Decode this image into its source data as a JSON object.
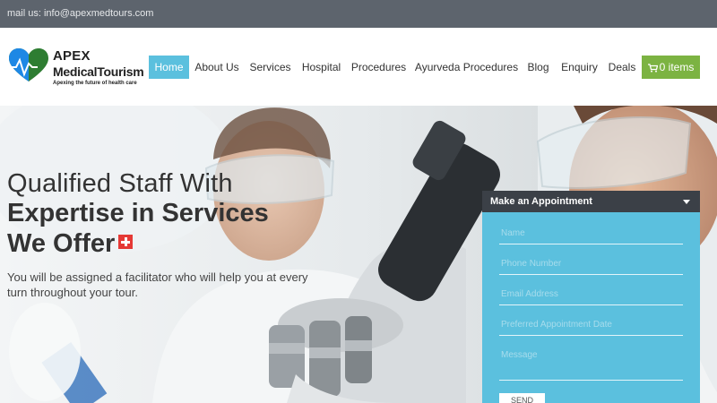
{
  "topbar": {
    "mail": "mail us: info@apexmedtours.com"
  },
  "logo": {
    "line1": "APEX",
    "line2": "MedicalTourism",
    "tagline": "Apexing the future of health care"
  },
  "nav": {
    "items": [
      {
        "label": "Home",
        "active": true
      },
      {
        "label": "About Us",
        "active": false
      },
      {
        "label": "Services",
        "active": false
      },
      {
        "label": "Hospital",
        "active": false
      },
      {
        "label": "Procedures",
        "active": false
      },
      {
        "label": "Ayurveda Procedures",
        "active": false
      },
      {
        "label": "Blog",
        "active": false
      },
      {
        "label": "Enquiry",
        "active": false
      },
      {
        "label": "Deals",
        "active": false
      }
    ],
    "cart_label": "0 items"
  },
  "hero": {
    "headline_line1": "Qualified Staff With",
    "headline_line2": "Expertise in Services",
    "headline_line3": "We Offer",
    "subtext": "You will be assigned a facilitator who will help you at every turn throughout your tour."
  },
  "appointment": {
    "title": "Make an Appointment",
    "fields": [
      {
        "placeholder": "Name"
      },
      {
        "placeholder": "Phone Number"
      },
      {
        "placeholder": "Email Address"
      },
      {
        "placeholder": "Preferred Appointment Date"
      },
      {
        "placeholder": "Message"
      }
    ],
    "submit_label": "SEND"
  },
  "colors": {
    "topbar": "#5d646d",
    "accent": "#5bc0de",
    "cart": "#7cb342",
    "form_header": "#3b4047"
  }
}
